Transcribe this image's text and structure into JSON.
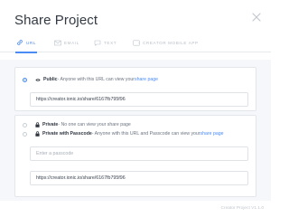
{
  "modal": {
    "title": "Share Project"
  },
  "tabs": [
    {
      "label": "URL",
      "icon": "link-icon",
      "active": true
    },
    {
      "label": "EMAIL",
      "icon": "mail-icon",
      "active": false
    },
    {
      "label": "TEXT",
      "icon": "chat-icon",
      "active": false
    },
    {
      "label": "CREATOR MOBILE APP",
      "icon": "phone-icon",
      "active": false
    }
  ],
  "public_option": {
    "label": "Public",
    "description": " - Anyone with this URL can view your ",
    "link": "share page",
    "url": "https://creator.ionic.io/share/6167fb795f96",
    "selected": true
  },
  "private_option": {
    "label": "Private",
    "description": " - No one can view your share page",
    "selected": false
  },
  "passcode_option": {
    "label": "Private with Passcode",
    "description": " - Anyone with this URL and Passcode can view your ",
    "link": "share page",
    "passcode_placeholder": "Enter a passcode",
    "url": "https://creator.ionic.io/share/6167fb795f96",
    "selected": false
  },
  "footer": {
    "version": "Creator Project V1.1.0"
  },
  "colors": {
    "accent": "#4a8bf5",
    "background": "#f5f7fa",
    "text": "#3b4450"
  }
}
